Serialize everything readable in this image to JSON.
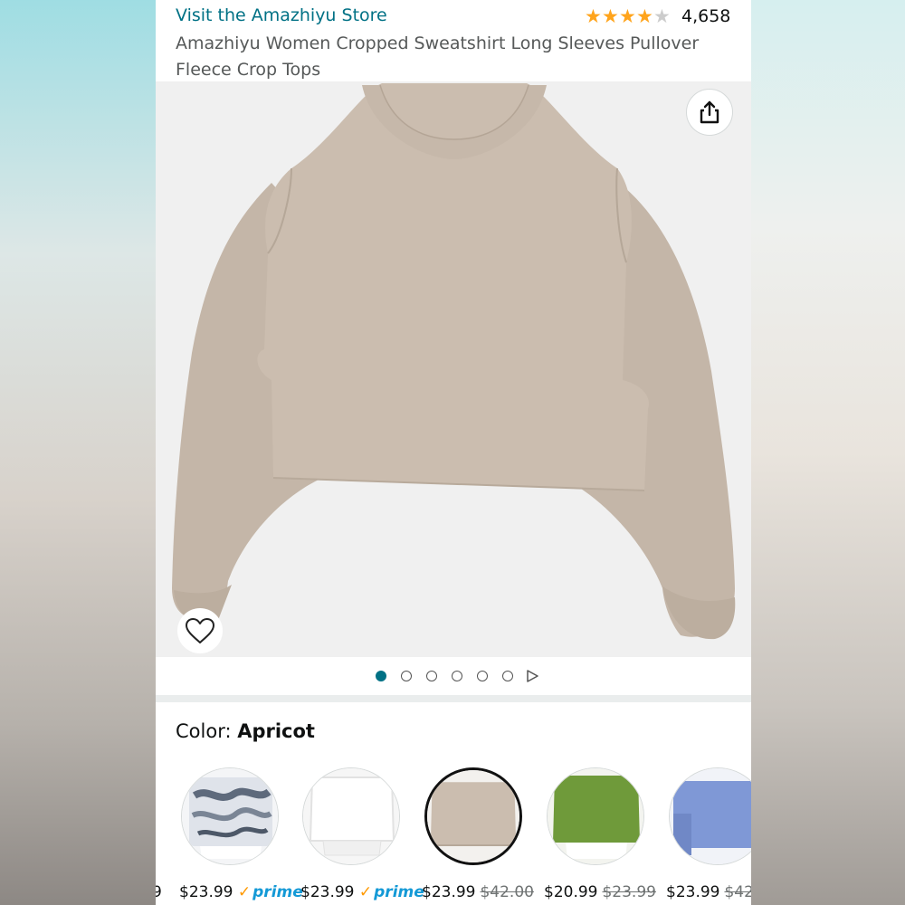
{
  "header": {
    "store_link": "Visit the Amazhiyu Store",
    "rating_stars": 4,
    "rating_count": "4,658",
    "title": "Amazhiyu Women Cropped Sweatshirt Long Sleeves Pullover Fleece Crop Tops"
  },
  "gallery": {
    "image_count": 6,
    "active_index": 0,
    "product_color_hex": "#cbbdaf"
  },
  "color": {
    "label": "Color: ",
    "value": "Apricot"
  },
  "swatches": [
    {
      "name": "tie-dye",
      "price": "$23.99",
      "prime_check": "✓",
      "prime": "prime",
      "list_price": ""
    },
    {
      "name": "white",
      "price": "$23.99",
      "prime_check": "✓",
      "prime": "prime",
      "list_price": ""
    },
    {
      "name": "apricot",
      "price": "$23.99",
      "prime_check": "",
      "prime": "",
      "list_price": "$42.00",
      "selected": true
    },
    {
      "name": "green",
      "price": "$20.99",
      "prime_check": "",
      "prime": "",
      "list_price": "$23.99"
    },
    {
      "name": "blue",
      "price": "$23.99",
      "prime_check": "",
      "prime": "",
      "list_price": "$42"
    }
  ],
  "colors": {
    "link": "#007185",
    "star": "#ffa41c",
    "prime": "#1399d6"
  }
}
